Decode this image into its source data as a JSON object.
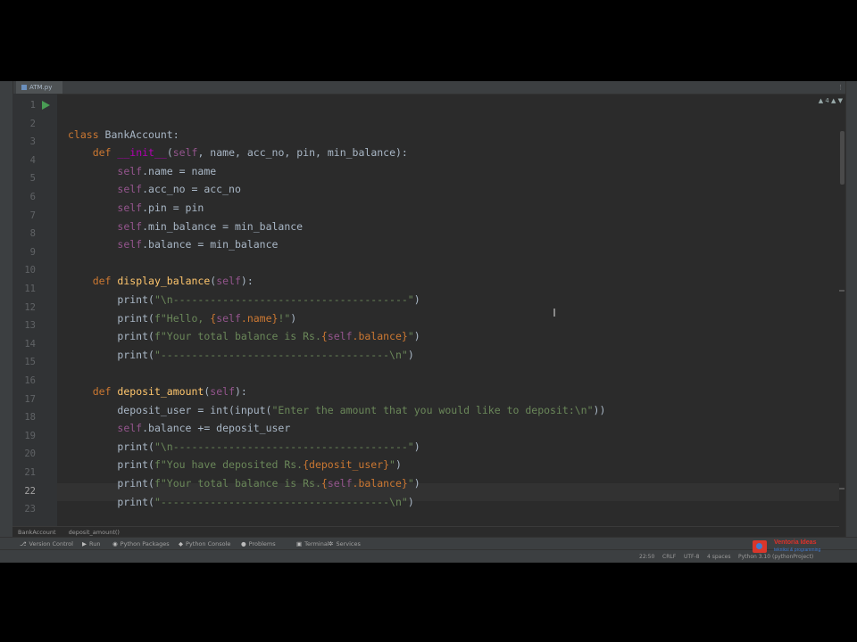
{
  "file_tab": {
    "name": "ATM.py"
  },
  "indicators": {
    "warnings": "▲ 4  ▲  ▼"
  },
  "code": {
    "line_numbers": [
      "1",
      "2",
      "3",
      "4",
      "5",
      "6",
      "7",
      "8",
      "9",
      "10",
      "11",
      "12",
      "13",
      "14",
      "15",
      "16",
      "17",
      "18",
      "19",
      "20",
      "21",
      "22",
      "23"
    ],
    "active_line": "22",
    "lines": [
      "",
      "class BankAccount:",
      "    def __init__(self, name, acc_no, pin, min_balance):",
      "        self.name = name",
      "        self.acc_no = acc_no",
      "        self.pin = pin",
      "        self.min_balance = min_balance",
      "        self.balance = min_balance",
      "",
      "    def display_balance(self):",
      "        print(\"\\n--------------------------------------\")",
      "        print(f\"Hello, {self.name}!\")",
      "        print(f\"Your total balance is Rs.{self.balance}\")",
      "        print(\"-------------------------------------\\n\")",
      "",
      "    def deposit_amount(self):",
      "        deposit_user = int(input(\"Enter the amount that you would like to deposit:\\n\"))",
      "        self.balance += deposit_user",
      "        print(\"\\n--------------------------------------\")",
      "        print(f\"You have deposited Rs.{deposit_user}\")",
      "        print(f\"Your total balance is Rs.{self.balance}\")",
      "        print(\"-------------------------------------\\n\")",
      ""
    ]
  },
  "breadcrumb": {
    "class": "BankAccount",
    "method": "deposit_amount()"
  },
  "toolwindows": [
    {
      "icon": "⎇",
      "label": "Version Control"
    },
    {
      "icon": "▶",
      "label": "Run"
    },
    {
      "icon": "◉",
      "label": "Python Packages"
    },
    {
      "icon": "◆",
      "label": "Python Console"
    },
    {
      "icon": "●",
      "label": "Problems"
    },
    {
      "icon": "▣",
      "label": "Terminal"
    },
    {
      "icon": "✲",
      "label": "Services"
    }
  ],
  "status": {
    "position": "22:50",
    "line_sep": "CRLF",
    "encoding": "UTF-8",
    "indent": "4 spaces",
    "interpreter": "Python 3.10 (pythonProject)"
  },
  "watermark": {
    "title": "Ventoria Ideas",
    "subtitle": "tekniksi & programming"
  },
  "colors": {
    "keyword": "#cc7832",
    "function": "#ffc66d",
    "string": "#6a8759",
    "self": "#94558d",
    "background": "#2b2b2b"
  }
}
